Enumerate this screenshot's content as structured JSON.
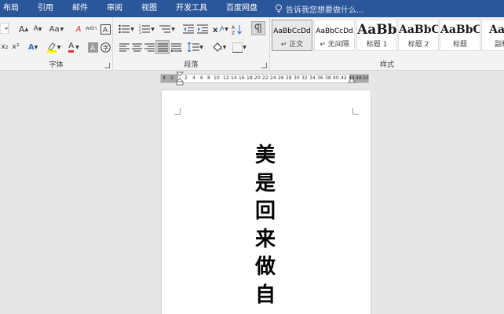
{
  "tabs": [
    "布局",
    "引用",
    "邮件",
    "审阅",
    "视图",
    "开发工具",
    "百度网盘"
  ],
  "tell_me": "告诉我您想要做什么...",
  "groups": {
    "font": "字体",
    "paragraph": "段落",
    "styles": "样式"
  },
  "font_buttons": {
    "change_case": "Aa",
    "grow": "A",
    "shrink": "A",
    "clear": "A",
    "wen": "wén",
    "subscript": "x₂",
    "superscript": "x²",
    "text_effects": "A",
    "highlight": "ab",
    "font_color": "A",
    "char_shading": "A",
    "enclose": "字"
  },
  "styles": [
    {
      "sample": "AaBbCcDd",
      "name": "↵ 正文",
      "kind": "normal"
    },
    {
      "sample": "AaBbCcDd",
      "name": "↵ 无间隔",
      "kind": "normal"
    },
    {
      "sample": "AaBb",
      "name": "标题 1",
      "kind": "heading1"
    },
    {
      "sample": "AaBbC",
      "name": "标题 2",
      "kind": "heading"
    },
    {
      "sample": "AaBbC",
      "name": "标题",
      "kind": "heading"
    },
    {
      "sample": "AaB",
      "name": "副标",
      "kind": "heading"
    }
  ],
  "ruler_ticks": [
    "4",
    "2",
    "2",
    "4",
    "6",
    "8",
    "10",
    "12",
    "14",
    "16",
    "18",
    "20",
    "22",
    "24",
    "26",
    "28",
    "30",
    "32",
    "34",
    "36",
    "38",
    "40",
    "42",
    "44",
    "48",
    "50"
  ],
  "document": {
    "vertical_text": [
      "美",
      "是",
      "回",
      "来",
      "做",
      "自"
    ]
  },
  "colors": {
    "tab_bar": "#2b579a",
    "ribbon": "#f3f3f3",
    "page": "#ffffff",
    "workspace": "#e6e6e6",
    "font_red": "#e03030",
    "highlight_yellow": "#ffef00"
  }
}
